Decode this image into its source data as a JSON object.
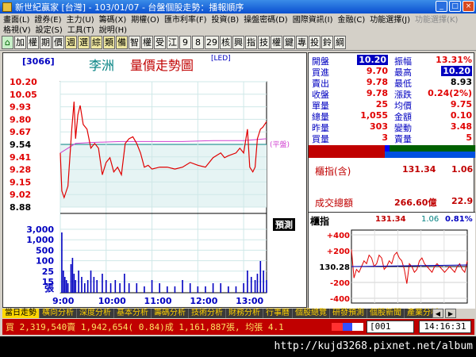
{
  "window": {
    "title": "新世紀贏家 [台灣] - 103/01/07 - 台盤個股走勢：播報順序",
    "min_label": "_",
    "max_label": "□",
    "close_label": "×"
  },
  "menu": {
    "row1": [
      {
        "label": "畫面(L)",
        "enabled": true
      },
      {
        "label": "證券(E)",
        "enabled": true
      },
      {
        "label": "主力(U)",
        "enabled": true
      },
      {
        "label": "籌碼(X)",
        "enabled": true
      },
      {
        "label": "期權(O)",
        "enabled": true
      },
      {
        "label": "匯市利率(F)",
        "enabled": true
      },
      {
        "label": "投資(B)",
        "enabled": true
      },
      {
        "label": "操盤密碼(D)",
        "enabled": true
      },
      {
        "label": "國際資訊(I)",
        "enabled": true
      },
      {
        "label": "金融(C)",
        "enabled": true
      },
      {
        "label": "功能選擇(J)",
        "enabled": true
      },
      {
        "label": "功能選擇(K)",
        "enabled": false
      }
    ],
    "row2": [
      {
        "label": "格視(V)",
        "enabled": true
      },
      {
        "label": "設定(S)",
        "enabled": true
      },
      {
        "label": "工具(T)",
        "enabled": true
      },
      {
        "label": "說明(H)",
        "enabled": true
      }
    ]
  },
  "toolbar": [
    "加",
    "權",
    "期",
    "價",
    "週",
    "選",
    "綜",
    "類",
    "備",
    "智",
    "權",
    "受",
    "江",
    "9",
    "8",
    "29",
    "核",
    "興",
    "指",
    "技",
    "權",
    "鍵",
    "專",
    "投",
    "鈴",
    "綱"
  ],
  "chart": {
    "stock_code": "[3066]",
    "stock_name": "李洲",
    "chart_title": "量價走勢圖",
    "led_label": "[LED]",
    "ref_label": "(平盤)",
    "forecast_label": "預測",
    "volume_unit": "張"
  },
  "chart_data": {
    "type": "line",
    "price_ticks": [
      "10.20",
      "10.05",
      "9.93",
      "9.80",
      "9.67",
      "9.54",
      "9.41",
      "9.28",
      "9.15",
      "9.02",
      "8.88"
    ],
    "reference_price": 9.54,
    "ylim": [
      8.88,
      10.2
    ],
    "volume_ticks": [
      "3,000",
      "1,000",
      "500",
      "100",
      "25",
      "15"
    ],
    "x_ticks": [
      "9:00",
      "10:00",
      "11:00",
      "12:00",
      "13:00"
    ],
    "price_series": [
      {
        "t": 0,
        "p": 9.45
      },
      {
        "t": 2,
        "p": 9.05
      },
      {
        "t": 5,
        "p": 8.98
      },
      {
        "t": 10,
        "p": 9.1
      },
      {
        "t": 15,
        "p": 9.7
      },
      {
        "t": 18,
        "p": 9.99
      },
      {
        "t": 20,
        "p": 9.6
      },
      {
        "t": 23,
        "p": 9.85
      },
      {
        "t": 26,
        "p": 9.95
      },
      {
        "t": 30,
        "p": 9.75
      },
      {
        "t": 35,
        "p": 9.7
      },
      {
        "t": 40,
        "p": 9.5
      },
      {
        "t": 45,
        "p": 9.55
      },
      {
        "t": 50,
        "p": 9.5
      },
      {
        "t": 55,
        "p": 9.22
      },
      {
        "t": 60,
        "p": 9.35
      },
      {
        "t": 65,
        "p": 9.4
      },
      {
        "t": 70,
        "p": 9.25
      },
      {
        "t": 75,
        "p": 9.3
      },
      {
        "t": 80,
        "p": 9.22
      },
      {
        "t": 85,
        "p": 9.55
      },
      {
        "t": 90,
        "p": 9.6
      },
      {
        "t": 95,
        "p": 9.62
      },
      {
        "t": 100,
        "p": 9.55
      },
      {
        "t": 105,
        "p": 9.45
      },
      {
        "t": 110,
        "p": 9.3
      },
      {
        "t": 115,
        "p": 9.32
      },
      {
        "t": 120,
        "p": 9.28
      },
      {
        "t": 130,
        "p": 9.3
      },
      {
        "t": 140,
        "p": 9.3
      },
      {
        "t": 150,
        "p": 9.28
      },
      {
        "t": 160,
        "p": 9.3
      },
      {
        "t": 170,
        "p": 9.35
      },
      {
        "t": 180,
        "p": 9.32
      },
      {
        "t": 190,
        "p": 9.3
      },
      {
        "t": 200,
        "p": 9.4
      },
      {
        "t": 210,
        "p": 9.45
      },
      {
        "t": 215,
        "p": 9.4
      },
      {
        "t": 220,
        "p": 9.42
      },
      {
        "t": 230,
        "p": 9.45
      },
      {
        "t": 235,
        "p": 9.5
      },
      {
        "t": 240,
        "p": 9.45
      },
      {
        "t": 245,
        "p": 9.7
      },
      {
        "t": 248,
        "p": 9.3
      },
      {
        "t": 252,
        "p": 9.25
      },
      {
        "t": 255,
        "p": 9.3
      },
      {
        "t": 258,
        "p": 9.6
      },
      {
        "t": 262,
        "p": 9.7
      },
      {
        "t": 265,
        "p": 9.72
      },
      {
        "t": 270,
        "p": 9.78
      }
    ],
    "avg_series": [
      {
        "t": 0,
        "p": 9.45
      },
      {
        "t": 10,
        "p": 9.5
      },
      {
        "t": 20,
        "p": 9.55
      },
      {
        "t": 40,
        "p": 9.56
      },
      {
        "t": 80,
        "p": 9.57
      },
      {
        "t": 120,
        "p": 9.57
      },
      {
        "t": 160,
        "p": 9.57
      },
      {
        "t": 200,
        "p": 9.58
      },
      {
        "t": 240,
        "p": 9.58
      },
      {
        "t": 270,
        "p": 9.6
      }
    ],
    "volume_bars": [
      {
        "t": 2,
        "v": 0.95
      },
      {
        "t": 4,
        "v": 0.35
      },
      {
        "t": 6,
        "v": 0.25
      },
      {
        "t": 8,
        "v": 0.2
      },
      {
        "t": 10,
        "v": 0.15
      },
      {
        "t": 14,
        "v": 0.45
      },
      {
        "t": 16,
        "v": 0.55
      },
      {
        "t": 18,
        "v": 0.3
      },
      {
        "t": 20,
        "v": 0.2
      },
      {
        "t": 24,
        "v": 0.35
      },
      {
        "t": 28,
        "v": 0.25
      },
      {
        "t": 32,
        "v": 0.15
      },
      {
        "t": 36,
        "v": 0.2
      },
      {
        "t": 40,
        "v": 0.35
      },
      {
        "t": 44,
        "v": 0.25
      },
      {
        "t": 48,
        "v": 0.2
      },
      {
        "t": 55,
        "v": 0.3
      },
      {
        "t": 60,
        "v": 0.2
      },
      {
        "t": 66,
        "v": 0.15
      },
      {
        "t": 72,
        "v": 0.2
      },
      {
        "t": 78,
        "v": 0.15
      },
      {
        "t": 84,
        "v": 0.3
      },
      {
        "t": 90,
        "v": 0.15
      },
      {
        "t": 100,
        "v": 0.15
      },
      {
        "t": 110,
        "v": 0.1
      },
      {
        "t": 120,
        "v": 0.2
      },
      {
        "t": 130,
        "v": 0.15
      },
      {
        "t": 140,
        "v": 0.1
      },
      {
        "t": 150,
        "v": 0.1
      },
      {
        "t": 160,
        "v": 0.2
      },
      {
        "t": 170,
        "v": 0.15
      },
      {
        "t": 180,
        "v": 0.1
      },
      {
        "t": 190,
        "v": 0.1
      },
      {
        "t": 200,
        "v": 0.15
      },
      {
        "t": 210,
        "v": 0.15
      },
      {
        "t": 220,
        "v": 0.1
      },
      {
        "t": 230,
        "v": 0.1
      },
      {
        "t": 240,
        "v": 0.15
      },
      {
        "t": 245,
        "v": 0.35
      },
      {
        "t": 250,
        "v": 0.25
      },
      {
        "t": 255,
        "v": 0.2
      },
      {
        "t": 258,
        "v": 0.3
      },
      {
        "t": 262,
        "v": 0.5
      },
      {
        "t": 266,
        "v": 0.35
      },
      {
        "t": 270,
        "v": 0.2
      }
    ]
  },
  "quote": {
    "rows": [
      {
        "l1": "開盤",
        "v1": "10.20",
        "v1_style": "hl",
        "l2": "振幅",
        "v2": "13.31%",
        "v2_style": "red"
      },
      {
        "l1": "買進",
        "v1": "9.70",
        "v1_style": "red",
        "l2": "最高",
        "v2": "10.20",
        "v2_style": "hl"
      },
      {
        "l1": "賣出",
        "v1": "9.78",
        "v1_style": "red",
        "l2": "最低",
        "v2": "8.93",
        "v2_style": "blk"
      },
      {
        "l1": "收盤",
        "v1": "9.78",
        "v1_style": "red",
        "l2": "漲跌",
        "v2": "0.24(2%)",
        "v2_style": "red"
      },
      {
        "l1": "單量",
        "v1": "25",
        "v1_style": "red",
        "l2": "均價",
        "v2": "9.75",
        "v2_style": "red"
      },
      {
        "l1": "總量",
        "v1": "1,055",
        "v1_style": "red",
        "l2": "金額",
        "v2": "0.10",
        "v2_style": "red"
      },
      {
        "l1": "昨量",
        "v1": "303",
        "v1_style": "red",
        "l2": "變動",
        "v2": "3.48",
        "v2_style": "red"
      },
      {
        "l1": "買量",
        "v1": "3",
        "v1_style": "red",
        "l2": "賣量",
        "v2": "5",
        "v2_style": "red"
      }
    ],
    "index_label": "櫃指(含)",
    "index_value": "131.34",
    "index_change": "1.06",
    "turnover_label": "成交總額",
    "turnover_value": "266.60億",
    "turnover_extra": "22.9"
  },
  "mini_index": {
    "label": "櫃指",
    "value": "131.34",
    "change": "1.06",
    "pct": "0.81%",
    "yticks": [
      "+400",
      "+200",
      "130.28",
      "-200",
      "-400"
    ],
    "points": [
      0.2,
      0.7,
      0.55,
      0.6,
      0.5,
      0.4,
      0.45,
      0.3,
      0.35,
      0.5,
      0.45,
      0.3,
      0.35,
      0.55,
      0.5,
      0.4,
      0.45,
      0.3,
      0.25,
      0.35,
      0.4,
      0.55,
      0.8,
      0.45,
      0.5,
      0.6,
      0.55,
      0.4,
      0.35,
      0.45,
      0.5,
      0.55,
      0.6,
      0.5,
      0.45,
      0.5,
      0.55,
      0.6,
      0.55,
      0.5,
      0.55,
      0.6,
      0.5,
      0.45,
      0.55,
      0.6,
      0.4
    ]
  },
  "bottom_tabs": [
    "當日走勢",
    "橫向分析",
    "深度分析",
    "基本分析",
    "籌碼分析",
    "技術分析",
    "財務分析",
    "行事曆",
    "個股總覽",
    "研發預測",
    "個股新聞",
    "產業分析"
  ],
  "status": {
    "text": "買 2,319,540賣 1,942,654( 0.84)成 1,161,887張, 均張 4.1",
    "code": "[001",
    "time": "14:16:31"
  },
  "footer": {
    "url": "http://kujd3268.pixnet.net/album"
  },
  "colors": {
    "up": "#e00000",
    "down": "#008000",
    "label": "#0000c0",
    "volume": "#0000c0",
    "avg": "#d040d0"
  }
}
